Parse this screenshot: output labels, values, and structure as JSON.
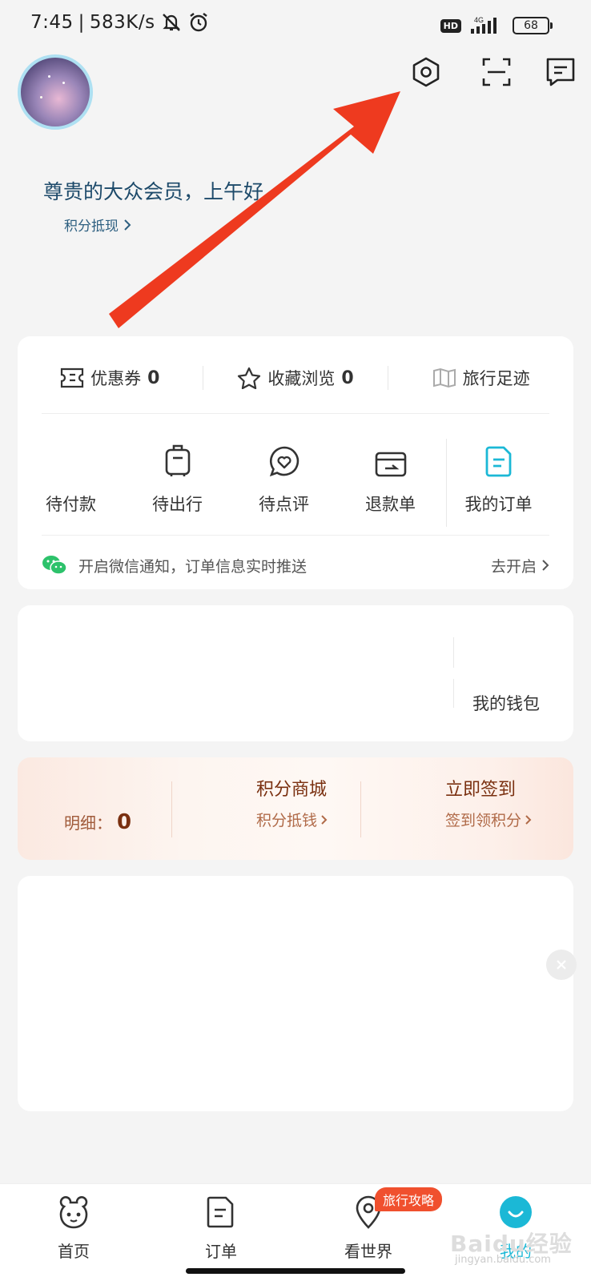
{
  "status_bar": {
    "time": "7:45",
    "speed": "583K/s",
    "network": "4G",
    "hd": "HD",
    "battery": "68"
  },
  "header": {
    "greeting": "尊贵的大众会员，上午好",
    "points_link": "积分抵现"
  },
  "shortcuts": [
    {
      "label": "优惠券",
      "count": "0"
    },
    {
      "label": "收藏浏览",
      "count": "0"
    },
    {
      "label": "旅行足迹"
    }
  ],
  "orders": [
    {
      "label": "待付款"
    },
    {
      "label": "待出行"
    },
    {
      "label": "待点评"
    },
    {
      "label": "退款单"
    },
    {
      "label": "我的订单"
    }
  ],
  "notify": {
    "text": "开启微信通知，订单信息实时推送",
    "action": "去开启"
  },
  "wallet": {
    "label": "我的钱包"
  },
  "points": {
    "detail_label": "明细：",
    "detail_value": "0",
    "mall_title": "积分商城",
    "mall_sub": "积分抵钱",
    "sign_title": "立即签到",
    "sign_sub": "签到领积分"
  },
  "tabs": [
    {
      "label": "首页"
    },
    {
      "label": "订单"
    },
    {
      "label": "看世界",
      "badge": "旅行攻略"
    },
    {
      "label": "我的"
    }
  ],
  "watermark": {
    "text": "Baidu经验",
    "sub": "jingyan.baidu.com"
  },
  "colors": {
    "accent": "#1bb8d6",
    "arrow": "#ee3a1f",
    "badge": "#f0502e",
    "points_text": "#7a3010"
  }
}
